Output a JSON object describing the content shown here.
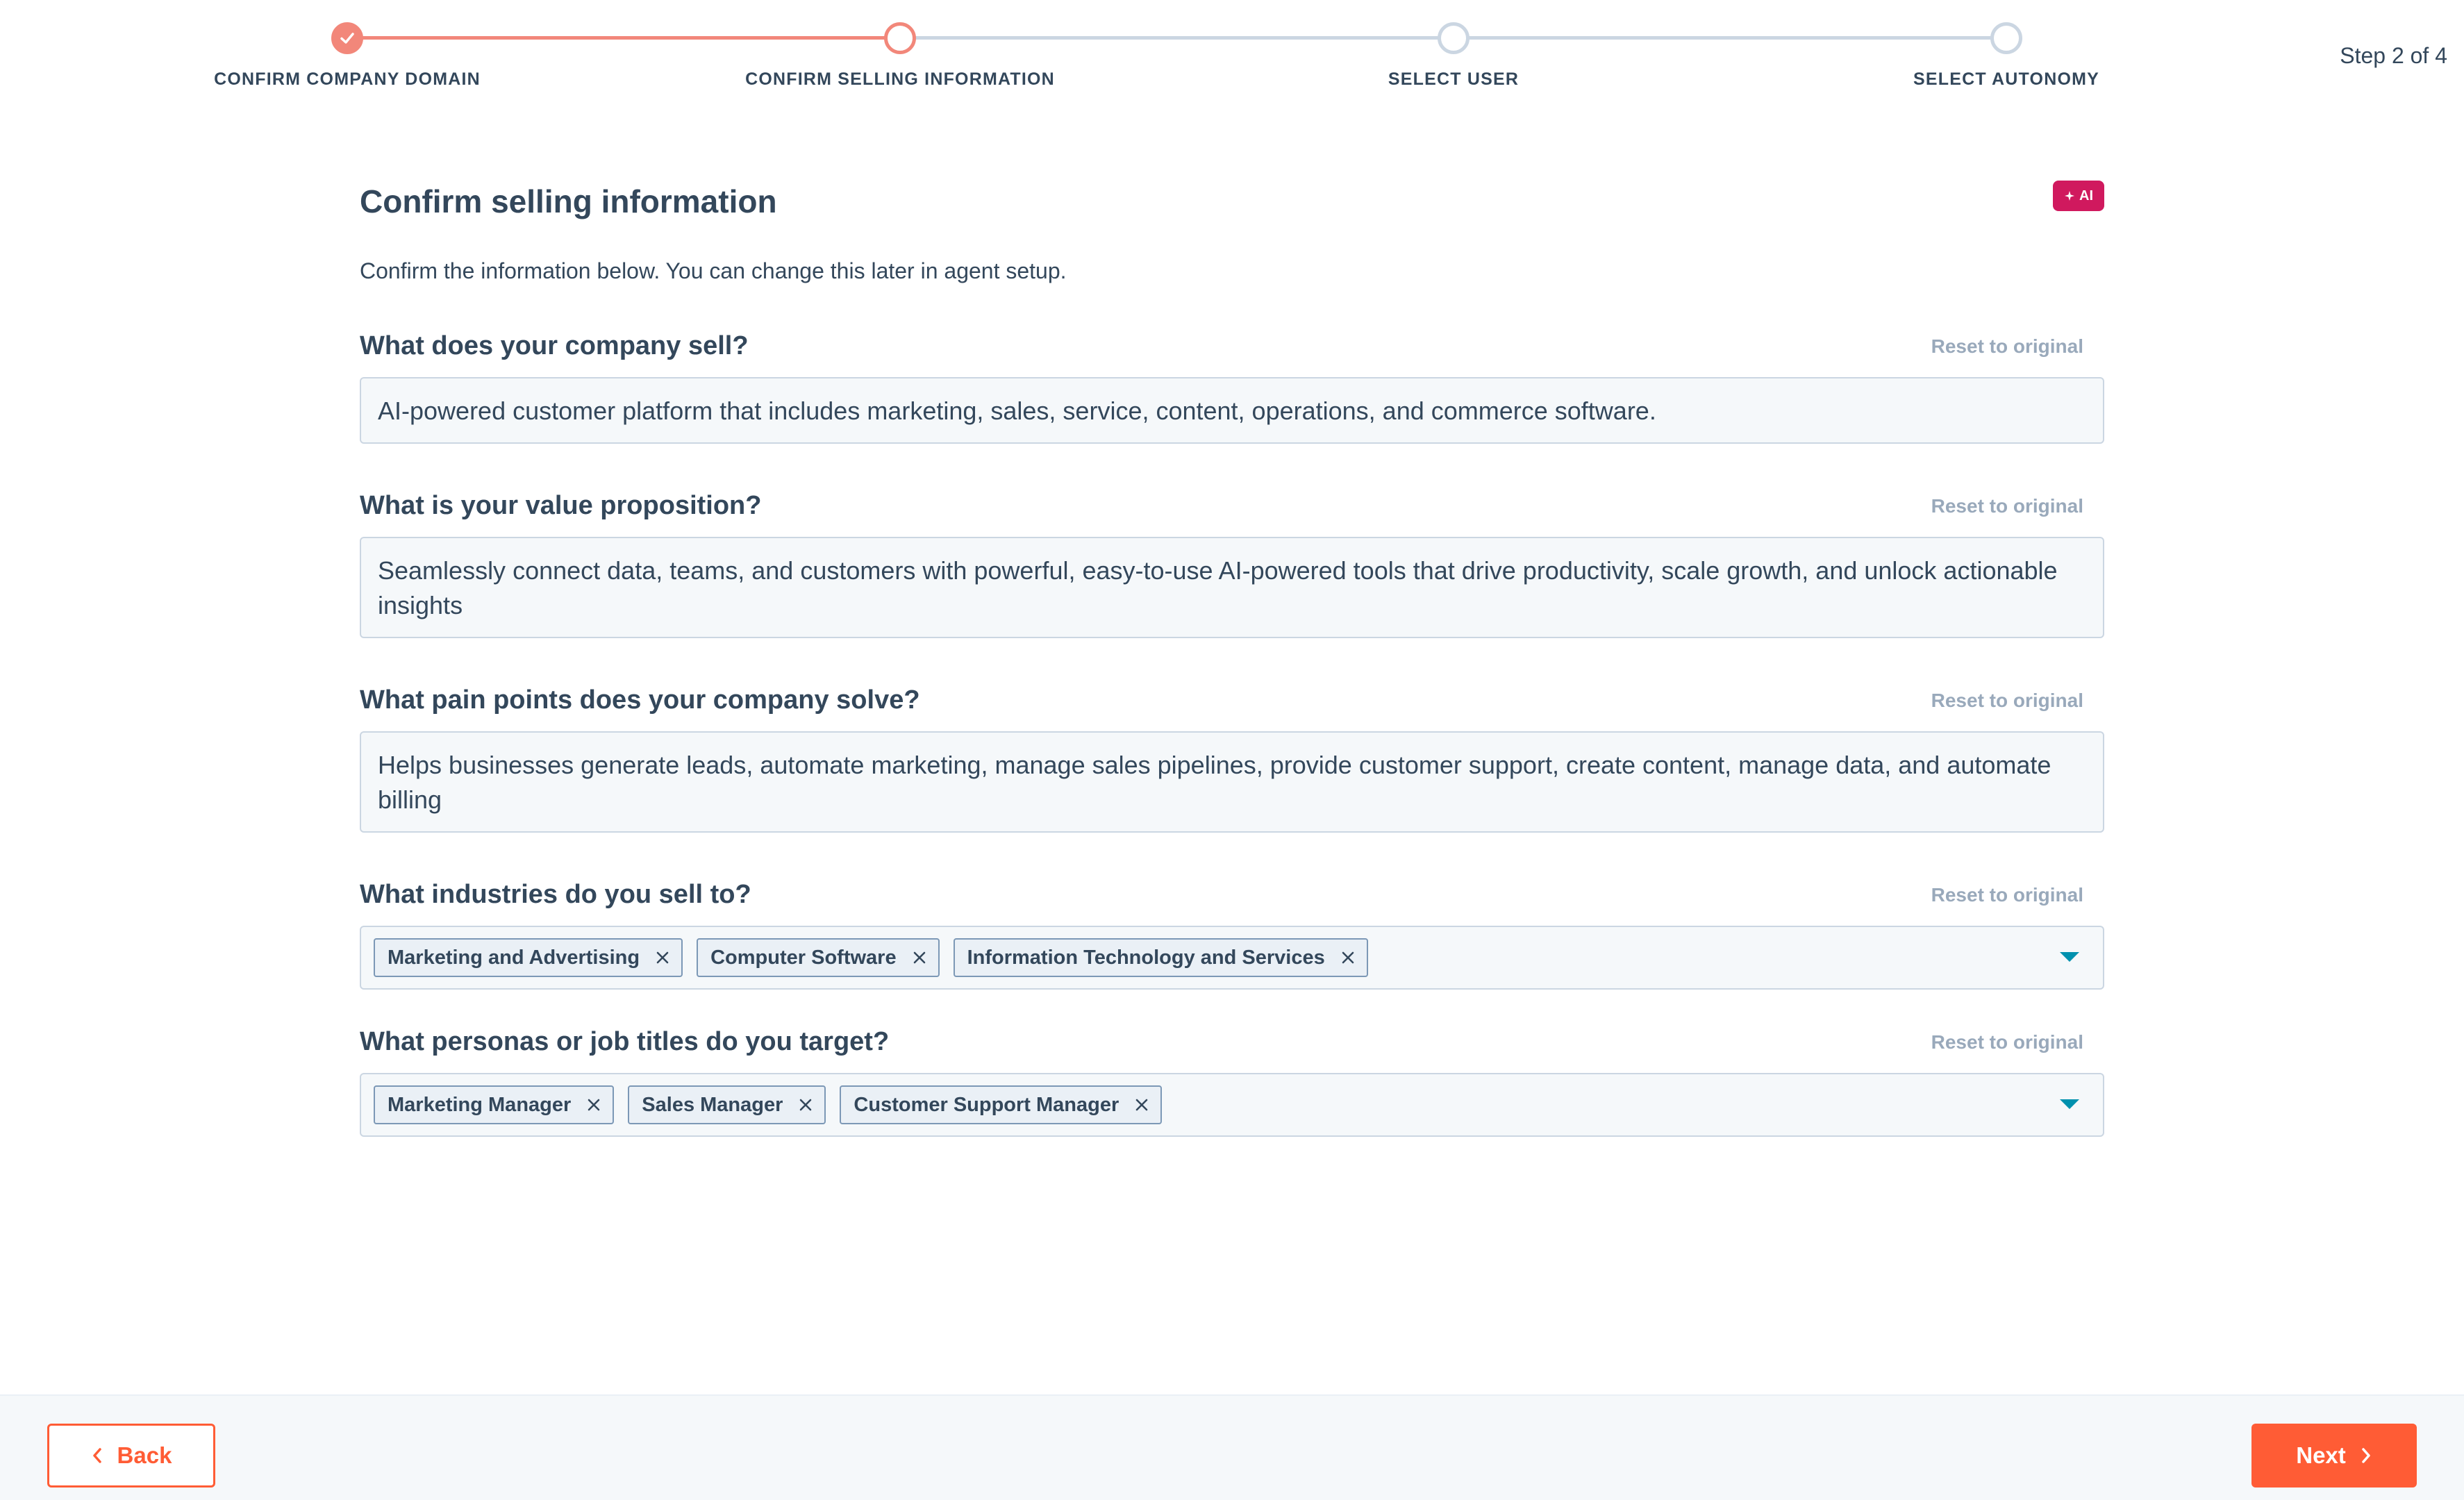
{
  "stepper": {
    "steps": [
      {
        "label": "CONFIRM COMPANY DOMAIN",
        "state": "complete"
      },
      {
        "label": "CONFIRM SELLING INFORMATION",
        "state": "active"
      },
      {
        "label": "SELECT USER",
        "state": "todo"
      },
      {
        "label": "SELECT AUTONOMY",
        "state": "todo"
      }
    ],
    "count": "Step 2 of 4"
  },
  "header": {
    "title": "Confirm selling information",
    "ai_badge": "AI",
    "subtitle": "Confirm the information below. You can change this later in agent setup."
  },
  "fields": {
    "sell": {
      "label": "What does your company sell?",
      "reset": "Reset to original",
      "value": "AI-powered customer platform that includes marketing, sales, service, content, operations, and commerce software."
    },
    "value_prop": {
      "label": "What is your value proposition?",
      "reset": "Reset to original",
      "value": "Seamlessly connect data, teams, and customers with powerful, easy-to-use AI-powered tools that drive productivity, scale growth, and unlock actionable insights"
    },
    "pain_points": {
      "label": "What pain points does your company solve?",
      "reset": "Reset to original",
      "value": "Helps businesses generate leads, automate marketing, manage sales pipelines, provide customer support, create content, manage data, and automate billing"
    },
    "industries": {
      "label": "What industries do you sell to?",
      "reset": "Reset to original",
      "tags": [
        "Marketing and Advertising",
        "Computer Software",
        "Information Technology and Services"
      ]
    },
    "personas": {
      "label": "What personas or job titles do you target?",
      "reset": "Reset to original",
      "tags": [
        "Marketing Manager",
        "Sales Manager",
        "Customer Support Manager"
      ]
    }
  },
  "footer": {
    "back_label": "Back",
    "next_label": "Next"
  },
  "colors": {
    "accent": "#ff5c35",
    "step_done": "#f2877a",
    "ai_badge": "#d0195e",
    "text": "#33475b",
    "muted": "#99a9bb",
    "caret": "#0091ae"
  },
  "icons": {
    "step_complete": "check-icon",
    "tag_remove": "close-icon",
    "dropdown": "caret-down-icon",
    "back": "chevron-left-icon",
    "next": "chevron-right-icon",
    "ai": "sparkle-icon"
  }
}
